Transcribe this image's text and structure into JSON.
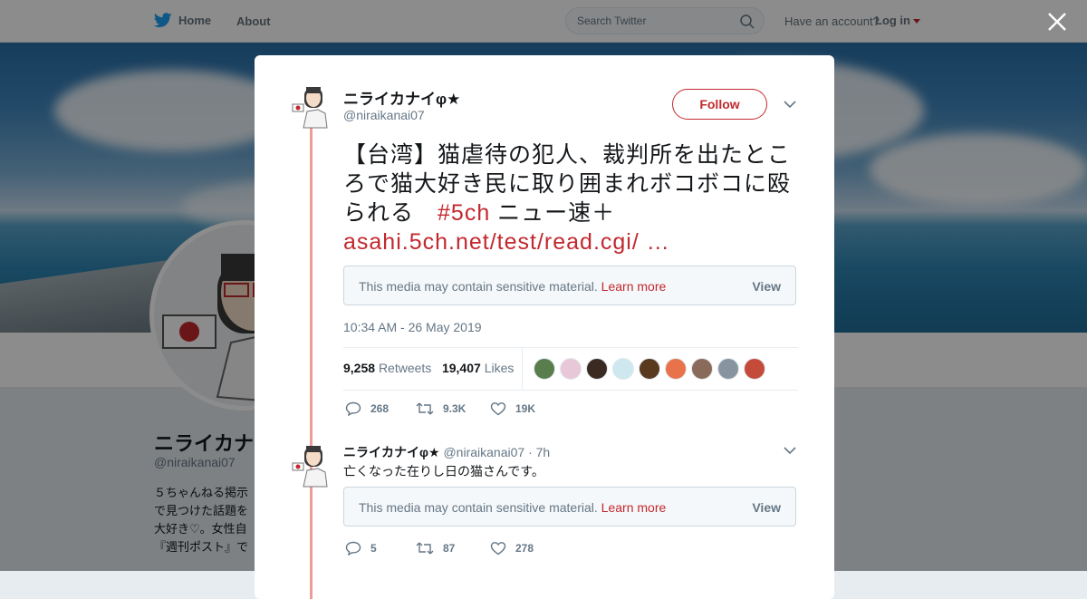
{
  "header": {
    "home_label": "Home",
    "about_label": "About",
    "search_placeholder": "Search Twitter",
    "have_account": "Have an account?",
    "login_label": "Log in"
  },
  "profile": {
    "name": "ニライカナ",
    "handle": "@niraikanai07",
    "bio_lines": [
      "５ちゃんねる掲示",
      "で見つけた話題を",
      "大好き♡。女性自",
      "『週刊ポスト』で"
    ]
  },
  "tweet": {
    "author_name": "ニライカナイφ★",
    "author_handle": "@niraikanai07",
    "follow_label": "Follow",
    "text": "【台湾】猫虐待の犯人、裁判所を出たところで猫大好き民に取り囲まれボコボコに殴られる　",
    "hashtag": "#5ch",
    "text_after": " ニュー速＋",
    "link": "asahi.5ch.net/test/read.cgi/ …",
    "sensitive_msg": "This media may contain sensitive material.",
    "learn_more": "Learn more",
    "view_label": "View",
    "timestamp": "10:34 AM - 26 May 2019",
    "retweets_count": "9,258",
    "retweets_label": "Retweets",
    "likes_count": "19,407",
    "likes_label": "Likes",
    "replies": "268",
    "retweets_short": "9.3K",
    "likes_short": "19K",
    "liker_colors": [
      "#5a7d4e",
      "#e8c8d8",
      "#3a2a22",
      "#cfe8f0",
      "#5a3a1e",
      "#e8734a",
      "#8a6a5a",
      "#8895a0",
      "#c44a3a"
    ]
  },
  "reply": {
    "author_name": "ニライカナイφ★",
    "author_handle": "@niraikanai07",
    "time_ago": "7h",
    "text": "亡くなった在りし日の猫さんです。",
    "sensitive_msg": "This media may contain sensitive material.",
    "learn_more": "Learn more",
    "view_label": "View",
    "replies": "5",
    "retweets": "87",
    "likes": "278"
  },
  "colors": {
    "accent": "#c2282e",
    "thread_line": "#f09a9a",
    "twitter_blue": "#1da1f2"
  }
}
